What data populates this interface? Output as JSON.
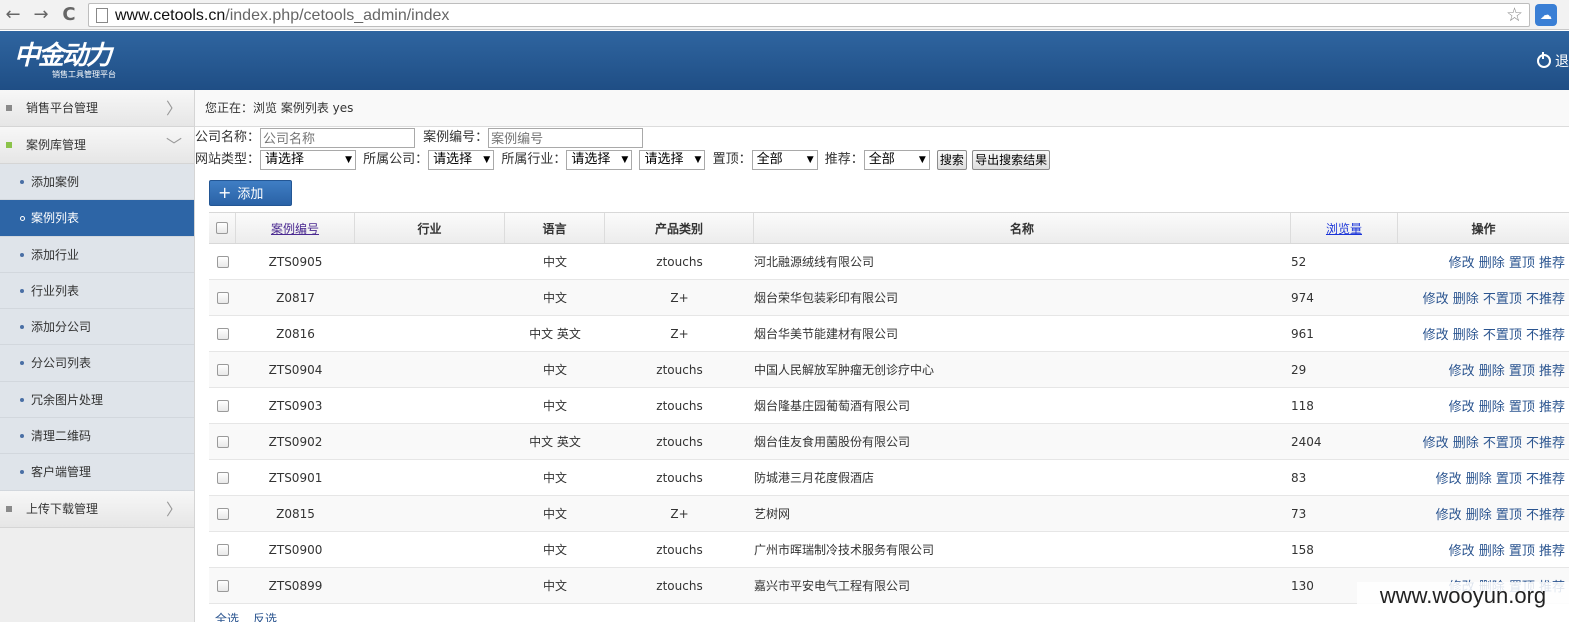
{
  "browser": {
    "back": "←",
    "forward": "→",
    "reload": "C",
    "url_domain": "www.cetools.cn",
    "url_path": "/index.php/cetools_admin/index",
    "star": "☆"
  },
  "header": {
    "logo_text": "中金动力",
    "logo_subtitle": "销售工具管理平台",
    "logout_label": "退"
  },
  "sidebar": {
    "groups": [
      {
        "label": "销售平台管理"
      },
      {
        "label": "案例库管理"
      },
      {
        "label": "上传下载管理"
      }
    ],
    "items": [
      {
        "label": "添加案例"
      },
      {
        "label": "案例列表"
      },
      {
        "label": "添加行业"
      },
      {
        "label": "行业列表"
      },
      {
        "label": "添加分公司"
      },
      {
        "label": "分公司列表"
      },
      {
        "label": "冗余图片处理"
      },
      {
        "label": "清理二维码"
      },
      {
        "label": "客户端管理"
      }
    ]
  },
  "breadcrumb": "您正在：浏览 案例列表 yes",
  "filters": {
    "company_label": "公司名称：",
    "company_placeholder": "公司名称",
    "code_label": "案例编号：",
    "code_placeholder": "案例编号",
    "site_type_label": "网站类型：",
    "site_type_value": "请选择",
    "branch_label": "所属公司：",
    "branch_value": "请选择",
    "industry_label": "所属行业：",
    "industry_value": "请选择",
    "industry2_value": "请选择",
    "top_label": "置顶：",
    "top_value": "全部",
    "recommend_label": "推荐：",
    "recommend_value": "全部",
    "search_btn": "搜索",
    "export_btn": "导出搜索结果"
  },
  "add_button": "添加",
  "add_icon": "+",
  "table": {
    "headers": {
      "code": "案例编号",
      "industry": "行业",
      "language": "语言",
      "product": "产品类别",
      "name": "名称",
      "views": "浏览量",
      "ops": "操作"
    },
    "rows": [
      {
        "code": "ZTS0905",
        "industry": "",
        "language": "中文",
        "product": "ztouchs",
        "name": "河北融源绒线有限公司",
        "views": "52",
        "ops": "修改 删除 置顶 推荐"
      },
      {
        "code": "Z0817",
        "industry": "",
        "language": "中文",
        "product": "Z+",
        "name": "烟台荣华包装彩印有限公司",
        "views": "974",
        "ops": "修改 删除 不置顶 不推荐"
      },
      {
        "code": "Z0816",
        "industry": "",
        "language": "中文 英文",
        "product": "Z+",
        "name": "烟台华美节能建材有限公司",
        "views": "961",
        "ops": "修改 删除 不置顶 不推荐"
      },
      {
        "code": "ZTS0904",
        "industry": "",
        "language": "中文",
        "product": "ztouchs",
        "name": "中国人民解放军肿瘤无创诊疗中心",
        "views": "29",
        "ops": "修改 删除 置顶 推荐"
      },
      {
        "code": "ZTS0903",
        "industry": "",
        "language": "中文",
        "product": "ztouchs",
        "name": "烟台隆基庄园葡萄酒有限公司",
        "views": "118",
        "ops": "修改 删除 置顶 推荐"
      },
      {
        "code": "ZTS0902",
        "industry": "",
        "language": "中文 英文",
        "product": "ztouchs",
        "name": "烟台佳友食用菌股份有限公司",
        "views": "2404",
        "ops": "修改 删除 不置顶 不推荐"
      },
      {
        "code": "ZTS0901",
        "industry": "",
        "language": "中文",
        "product": "ztouchs",
        "name": "防城港三月花度假酒店",
        "views": "83",
        "ops": "修改 删除 置顶 不推荐"
      },
      {
        "code": "Z0815",
        "industry": "",
        "language": "中文",
        "product": "Z+",
        "name": "艺树网",
        "views": "73",
        "ops": "修改 删除 置顶 不推荐"
      },
      {
        "code": "ZTS0900",
        "industry": "",
        "language": "中文",
        "product": "ztouchs",
        "name": "广州市晖瑞制冷技术服务有限公司",
        "views": "158",
        "ops": "修改 删除 置顶 推荐"
      },
      {
        "code": "ZTS0899",
        "industry": "",
        "language": "中文",
        "product": "ztouchs",
        "name": "嘉兴市平安电气工程有限公司",
        "views": "130",
        "ops": "修改 删除 置顶 推荐"
      }
    ]
  },
  "bottom": {
    "select_all": "全选",
    "invert": "反选"
  },
  "watermark": "www.wooyun.org"
}
